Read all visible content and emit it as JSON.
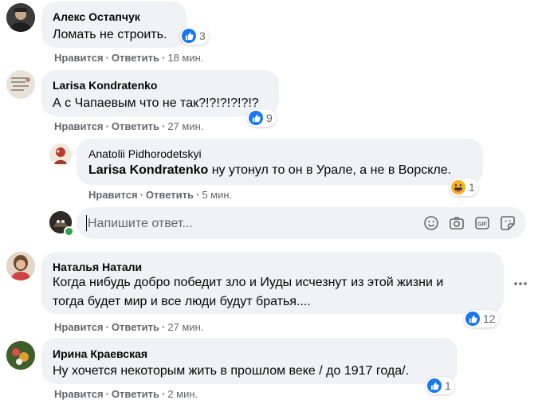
{
  "colors": {
    "bubble": "#f0f2f5",
    "like": "#1877f2",
    "haha": "#f7b125",
    "meta": "#65676b"
  },
  "comments": [
    {
      "author": "Алекс Остапчук",
      "text": [
        "Ломать не строить."
      ],
      "like": "Нравится",
      "reply": "Ответить",
      "time": "18 мин.",
      "reaction": {
        "icon": "like-icon",
        "count": "3"
      }
    },
    {
      "author": "Larisa Kondratenko",
      "text": [
        "А с Чапаевым что не так?!?!?!?!?!?"
      ],
      "like": "Нравится",
      "reply": "Ответить",
      "time": "27 мин.",
      "reaction": {
        "icon": "like-icon",
        "count": "9"
      }
    },
    {
      "author": "Anatolii Pidhorodetskyi",
      "mention": "Larisa Kondratenko",
      "text": [
        " ну утонул то он в Урале, а не в Ворскле."
      ],
      "like": "Нравится",
      "reply": "Ответить",
      "time": "5 мин.",
      "reaction": {
        "icon": "haha-icon",
        "count": "1"
      }
    },
    {
      "author": "Наталья Натали",
      "text": [
        "Когда нибудь добро победит зло и Иуды исчезнут из этой жизни и",
        "тогда будет мир и все люди будут братья...."
      ],
      "like": "Нравится",
      "reply": "Ответить",
      "time": "27 мин.",
      "reaction": {
        "icon": "like-icon",
        "count": "12"
      }
    },
    {
      "author": "Ирина Краевская",
      "text": [
        "Ну хочется некоторым жить в прошлом веке / до 1917 года/."
      ],
      "like": "Нравится",
      "reply": "Ответить",
      "time": "2 мин.",
      "reaction": {
        "icon": "like-icon",
        "count": "1"
      }
    }
  ],
  "reply_box": {
    "placeholder": "Напишите ответ...",
    "tools": [
      "emoji-icon",
      "camera-icon",
      "gif-icon",
      "sticker-icon"
    ]
  }
}
